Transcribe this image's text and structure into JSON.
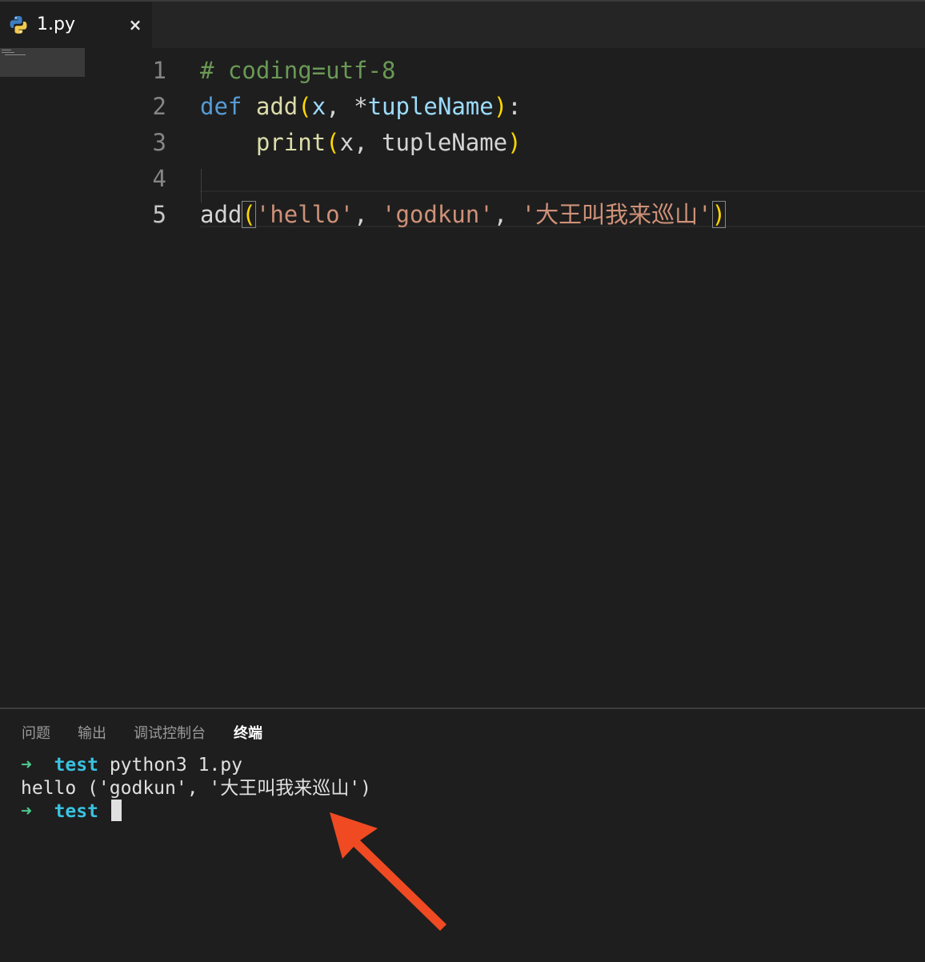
{
  "tab": {
    "filename": "1.py",
    "close_glyph": "×",
    "icon": "python-icon"
  },
  "editor": {
    "lines": [
      {
        "num": "1",
        "tokens": [
          {
            "t": "# coding=utf-8",
            "c": "comment"
          }
        ]
      },
      {
        "num": "2",
        "tokens": [
          {
            "t": "def",
            "c": "kw"
          },
          {
            "t": " ",
            "c": "plain"
          },
          {
            "t": "add",
            "c": "fn"
          },
          {
            "t": "(",
            "c": "paren"
          },
          {
            "t": "x",
            "c": "param"
          },
          {
            "t": ", ",
            "c": "plain"
          },
          {
            "t": "*",
            "c": "plain"
          },
          {
            "t": "tupleName",
            "c": "param"
          },
          {
            "t": ")",
            "c": "paren"
          },
          {
            "t": ":",
            "c": "plain"
          }
        ]
      },
      {
        "num": "3",
        "tokens": [
          {
            "t": "    ",
            "c": "plain"
          },
          {
            "t": "print",
            "c": "fn"
          },
          {
            "t": "(",
            "c": "paren"
          },
          {
            "t": "x, tupleName",
            "c": "plain"
          },
          {
            "t": ")",
            "c": "paren"
          }
        ]
      },
      {
        "num": "4",
        "tokens": []
      },
      {
        "num": "5",
        "tokens": [
          {
            "t": "add",
            "c": "plain"
          },
          {
            "t": "(",
            "c": "paren",
            "box": true
          },
          {
            "t": "'hello'",
            "c": "str"
          },
          {
            "t": ", ",
            "c": "plain"
          },
          {
            "t": "'godkun'",
            "c": "str"
          },
          {
            "t": ", ",
            "c": "plain"
          },
          {
            "t": "'大王叫我来巡山'",
            "c": "str"
          },
          {
            "t": ")",
            "c": "paren",
            "box": true
          }
        ]
      }
    ],
    "active_line": "5"
  },
  "panel": {
    "tabs": [
      "问题",
      "输出",
      "调试控制台",
      "终端"
    ],
    "active_tab": "终端"
  },
  "terminal": {
    "lines": [
      {
        "arrow": "➜",
        "dir": "test",
        "cmd": "python3 1.py"
      },
      {
        "output": "hello ('godkun', '大王叫我来巡山')"
      },
      {
        "arrow": "➜",
        "dir": "test",
        "cmd": ""
      }
    ]
  },
  "colors": {
    "background": "#1e1e1e",
    "comment": "#6a9955",
    "keyword": "#569cd6",
    "function": "#dcdcaa",
    "parameter": "#9cdcfe",
    "string": "#ce9178",
    "bracket": "#ffd700",
    "terminal_arrow": "#4ec98f",
    "terminal_dir": "#39c2e0",
    "annotation_arrow": "#f04a23"
  }
}
